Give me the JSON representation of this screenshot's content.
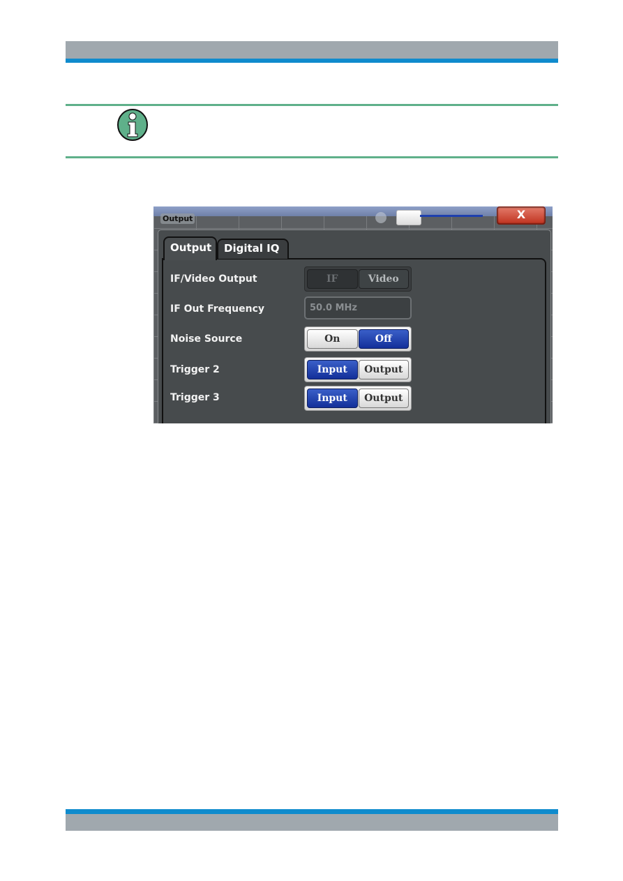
{
  "page": {
    "colors": {
      "header_gray": "#a0a8ae",
      "header_blue": "#0f8bcd",
      "note_green": "#5fb08a"
    },
    "note": {
      "icon": "info-icon"
    }
  },
  "dialog": {
    "title": "Output",
    "close_label": "X",
    "tabs": [
      {
        "label": "Output",
        "active": true
      },
      {
        "label": "Digital IQ",
        "active": false
      }
    ],
    "rows": [
      {
        "label": "IF/Video Output",
        "type": "toggle",
        "options": [
          "IF",
          "Video"
        ],
        "selected": "IF",
        "enabled": false
      },
      {
        "label": "IF Out Frequency",
        "type": "field",
        "value": "50.0 MHz",
        "enabled": false
      },
      {
        "label": "Noise Source",
        "type": "toggle",
        "options": [
          "On",
          "Off"
        ],
        "selected": "Off",
        "enabled": true
      },
      {
        "label": "Trigger 2",
        "type": "toggle",
        "options": [
          "Input",
          "Output"
        ],
        "selected": "Input",
        "enabled": true
      },
      {
        "label": "Trigger 3",
        "type": "toggle",
        "options": [
          "Input",
          "Output"
        ],
        "selected": "Input",
        "enabled": true
      }
    ]
  }
}
